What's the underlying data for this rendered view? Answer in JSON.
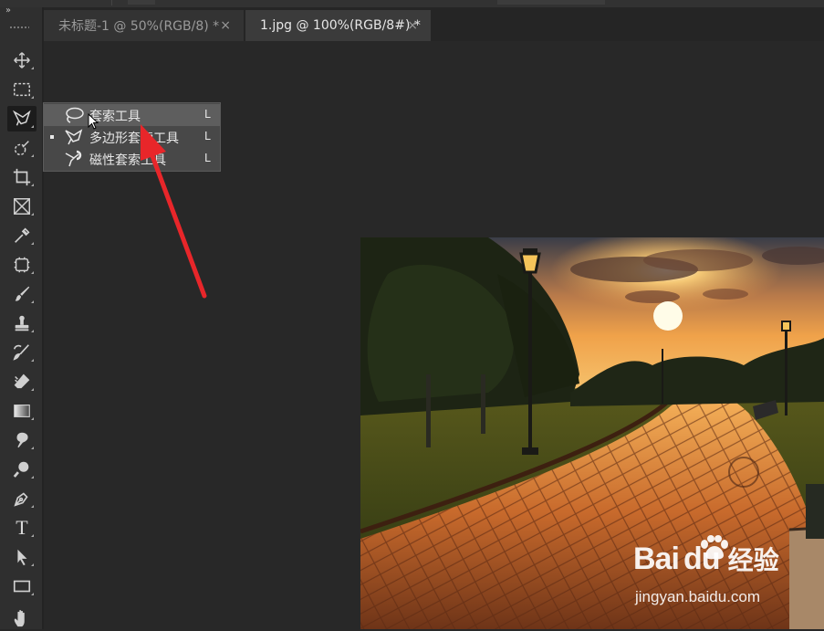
{
  "top_strip": {
    "collapse_glyph": "››"
  },
  "tabs": [
    {
      "label": "未标题-1 @ 50%(RGB/8) *",
      "close": "×"
    },
    {
      "label": "1.jpg @ 100%(RGB/8#) *",
      "close": "×"
    }
  ],
  "toolbar": {
    "tools": [
      {
        "name": "move-tool",
        "icon": "move-icon"
      },
      {
        "name": "marquee-tool",
        "icon": "rect-marquee-icon"
      },
      {
        "name": "lasso-tool",
        "icon": "polygonal-lasso-icon",
        "active": true
      },
      {
        "name": "quick-selection-tool",
        "icon": "quick-select-icon"
      },
      {
        "name": "crop-tool",
        "icon": "crop-icon"
      },
      {
        "name": "frame-tool",
        "icon": "frame-icon"
      },
      {
        "name": "eyedropper-tool",
        "icon": "eyedropper-icon"
      },
      {
        "name": "healing-tool",
        "icon": "patch-icon"
      },
      {
        "name": "brush-tool",
        "icon": "brush-icon"
      },
      {
        "name": "stamp-tool",
        "icon": "stamp-icon"
      },
      {
        "name": "history-brush-tool",
        "icon": "history-brush-icon"
      },
      {
        "name": "eraser-tool",
        "icon": "eraser-icon"
      },
      {
        "name": "gradient-tool",
        "icon": "gradient-icon"
      },
      {
        "name": "blur-tool",
        "icon": "blur-icon"
      },
      {
        "name": "dodge-tool",
        "icon": "dodge-icon"
      },
      {
        "name": "pen-tool",
        "icon": "pen-icon"
      },
      {
        "name": "type-tool",
        "icon": "type-icon",
        "glyph": "T"
      },
      {
        "name": "path-selection-tool",
        "icon": "arrow-icon"
      },
      {
        "name": "shape-tool",
        "icon": "rectangle-icon"
      },
      {
        "name": "hand-tool",
        "icon": "hand-icon"
      }
    ]
  },
  "flyout": {
    "items": [
      {
        "label": "套索工具",
        "shortcut": "L",
        "icon": "lasso-icon",
        "highlighted": true,
        "current": false
      },
      {
        "label": "多边形套索工具",
        "shortcut": "L",
        "icon": "polygonal-lasso-icon",
        "highlighted": false,
        "current": true
      },
      {
        "label": "磁性套索工具",
        "shortcut": "L",
        "icon": "magnetic-lasso-icon",
        "highlighted": false,
        "current": false
      }
    ]
  },
  "watermark": {
    "brand": "Bai",
    "brand_end": "du",
    "suffix": "经验",
    "url": "jingyan.baidu.com"
  },
  "colors": {
    "annotation_arrow": "#e8262a",
    "ui_bg": "#282828",
    "panel": "#2f2f2f",
    "menu_bg": "#484848",
    "menu_highlight": "#5e5e5e"
  }
}
